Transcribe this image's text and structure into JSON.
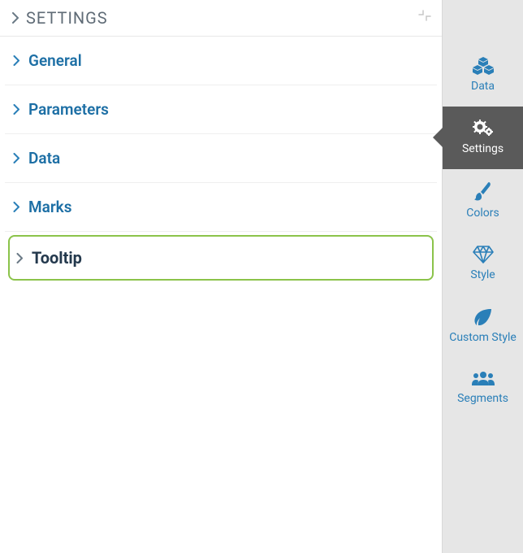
{
  "panel": {
    "title": "SETTINGS"
  },
  "sections": {
    "general": "General",
    "parameters": "Parameters",
    "data": "Data",
    "marks": "Marks",
    "tooltip": "Tooltip"
  },
  "rail": {
    "data": "Data",
    "settings": "Settings",
    "colors": "Colors",
    "style": "Style",
    "custom_style": "Custom Style",
    "segments": "Segments"
  },
  "colors": {
    "link": "#1d6fa5",
    "chevron": "#2a7fb8",
    "highlight_border": "#8bc34a",
    "rail_bg": "#e6e6e6",
    "rail_active_bg": "#5a5a5a"
  }
}
